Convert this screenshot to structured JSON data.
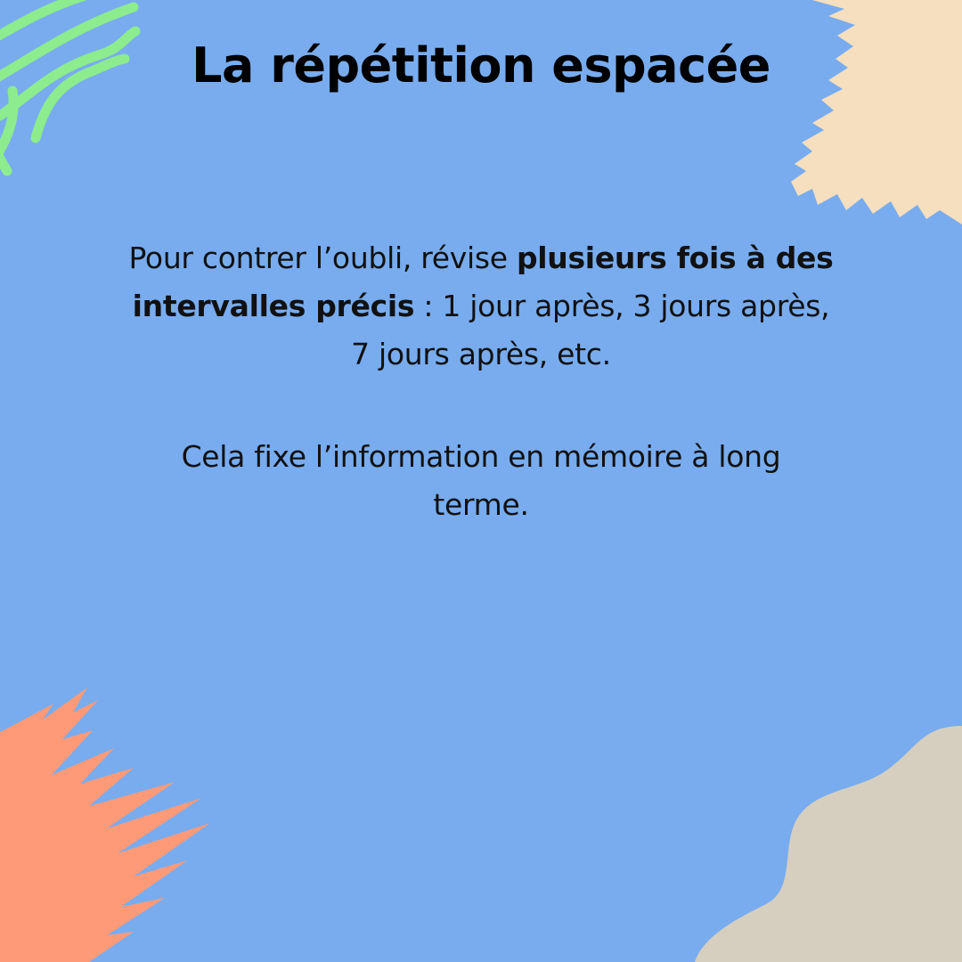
{
  "colors": {
    "background": "#78ACEE",
    "title_text": "#000000",
    "body_text": "#111111",
    "green_lines": "#8CEC8E",
    "peach_brush": "#F5DFBF",
    "coral_brush": "#FF9A78",
    "taupe_blob": "#D6CFBF"
  },
  "title": "La répétition espacée",
  "paragraph1": {
    "before_bold": "Pour contrer l’oubli, révise ",
    "bold": "plusieurs fois à des intervalles précis",
    "after_bold": " : 1 jour après, 3 jours après, 7 jours après, etc."
  },
  "paragraph2": "Cela fixe l’information en mémoire à long terme.",
  "decorations": {
    "top_left": "green-wavy-lines",
    "top_right": "peach-brush-stroke",
    "bottom_left": "coral-brush-stroke",
    "bottom_right": "taupe-blob"
  }
}
